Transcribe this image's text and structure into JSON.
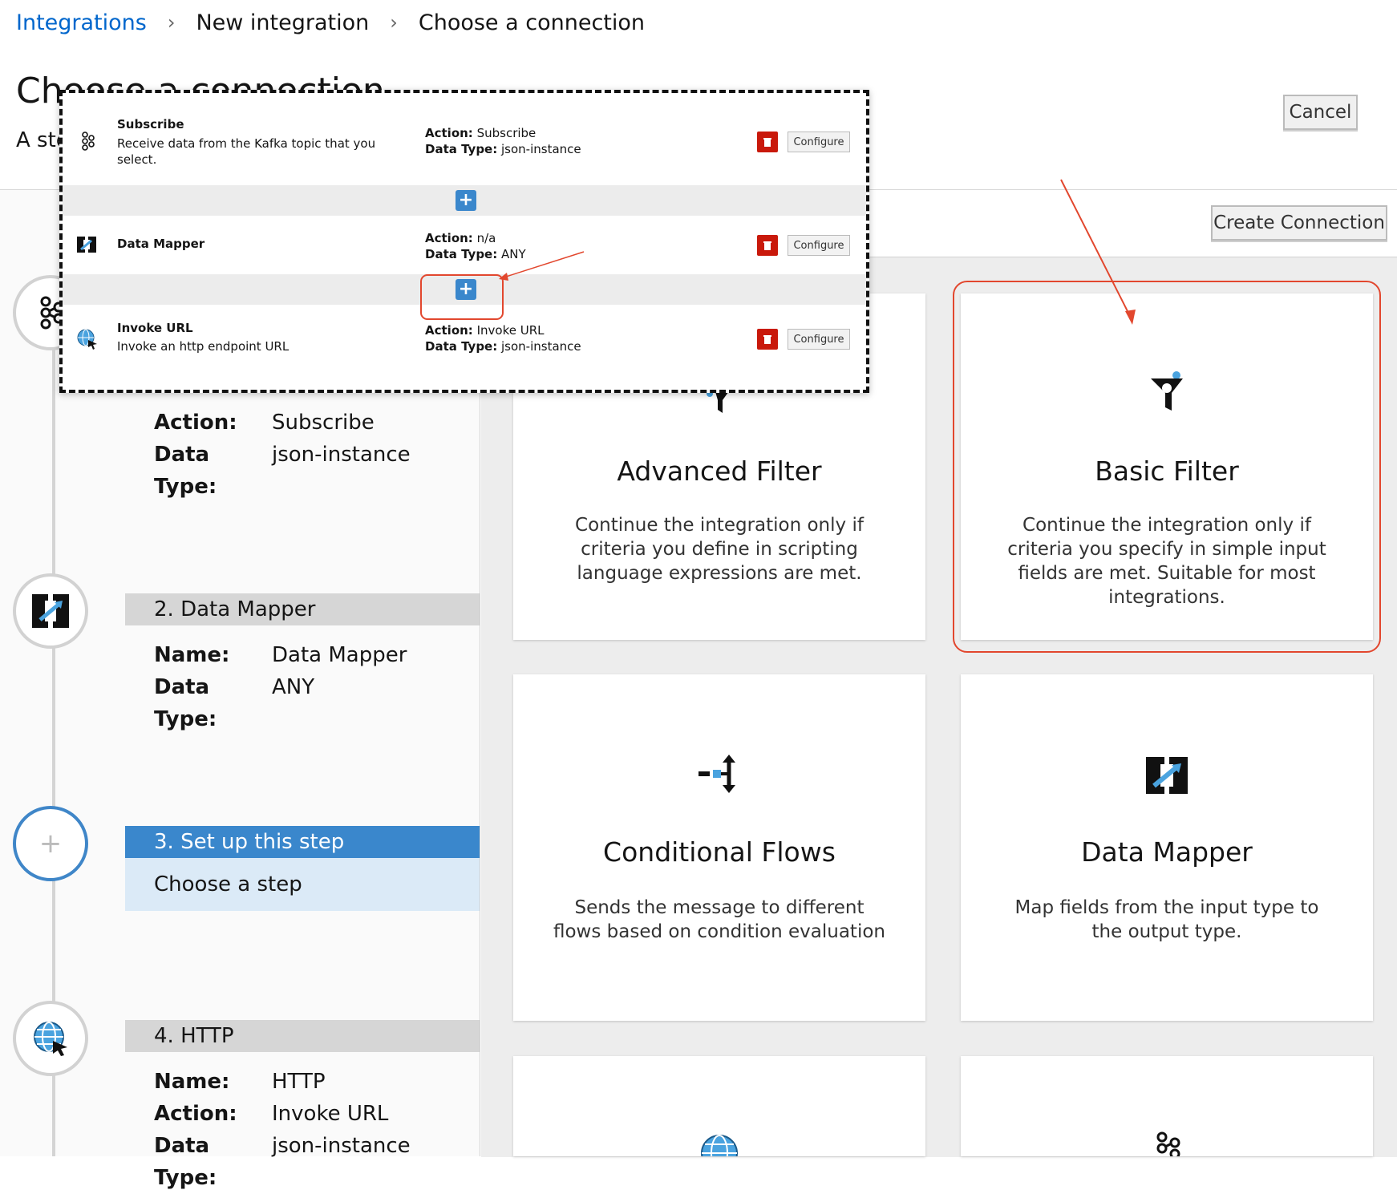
{
  "breadcrumb": {
    "root": "Integrations",
    "second": "New integration",
    "current": "Choose a connection"
  },
  "header": {
    "title": "Choose a connection",
    "description_visible": "A ste",
    "cancel_label": "Cancel",
    "create_connection_label": "Create Connection"
  },
  "steps": [
    {
      "header": "",
      "fields": [
        {
          "key": "Action:",
          "value": "Subscribe"
        },
        {
          "key": "Data Type:",
          "value": "json-instance"
        }
      ],
      "icon": "kafka-icon"
    },
    {
      "header": "2. Data Mapper",
      "fields": [
        {
          "key": "Name:",
          "value": "Data Mapper"
        },
        {
          "key": "Data Type:",
          "value": "ANY"
        }
      ],
      "icon": "data-mapper-icon"
    },
    {
      "header": "3. Set up this step",
      "sub": "Choose a step",
      "icon": "plus-icon"
    },
    {
      "header": "4. HTTP",
      "fields": [
        {
          "key": "Name:",
          "value": "HTTP"
        },
        {
          "key": "Action:",
          "value": "Invoke URL"
        },
        {
          "key": "Data Type:",
          "value": "json-instance"
        }
      ],
      "icon": "globe-icon"
    }
  ],
  "cards": [
    {
      "title": "Advanced Filter",
      "desc": "Continue the integration only if criteria you define in scripting language expressions are met.",
      "icon": "advanced-filter-icon"
    },
    {
      "title": "Basic Filter",
      "desc": "Continue the integration only if criteria you specify in simple input fields are met. Suitable for most integrations.",
      "icon": "basic-filter-icon"
    },
    {
      "title": "Conditional Flows",
      "desc": "Sends the message to different flows based on condition evaluation",
      "icon": "conditional-flows-icon"
    },
    {
      "title": "Data Mapper",
      "desc": "Map fields from the input type to the output type.",
      "icon": "data-mapper-icon"
    },
    {
      "title": "",
      "desc": "",
      "icon": "globe-icon"
    },
    {
      "title": "",
      "desc": "",
      "icon": "kafka-icon"
    }
  ],
  "overlay": {
    "rows": [
      {
        "name": "Subscribe",
        "desc": "Receive data from the Kafka topic that you select.",
        "action": "Subscribe",
        "data_type": "json-instance",
        "icon": "kafka-icon"
      },
      {
        "name": "Data Mapper",
        "desc": "",
        "action": "n/a",
        "data_type": "ANY",
        "icon": "data-mapper-icon"
      },
      {
        "name": "Invoke URL",
        "desc": "Invoke an http endpoint URL",
        "action": "Invoke URL",
        "data_type": "json-instance",
        "icon": "globe-icon"
      }
    ],
    "action_label": "Action:",
    "data_type_label": "Data Type:",
    "configure_label": "Configure"
  },
  "colors": {
    "accent": "#3a87cc",
    "annotation": "#e2472e",
    "delete": "#c9190b",
    "link": "#0066cc"
  }
}
